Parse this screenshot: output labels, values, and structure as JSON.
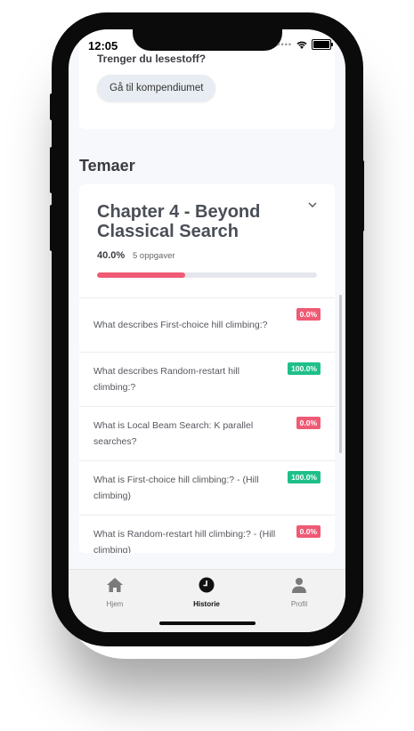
{
  "status": {
    "time": "12:05"
  },
  "top_card": {
    "question": "Trenger du lesestoff?",
    "button_label": "Gå til kompendiumet"
  },
  "section_title": "Temaer",
  "chapter": {
    "title": "Chapter 4 - Beyond Classical Search",
    "progress_label": "40.0%",
    "progress_fraction": 0.4,
    "task_count": "5 oppgaver",
    "items": [
      {
        "text": "What describes First-choice hill climbing:?",
        "badge": "0.0%",
        "status": "red"
      },
      {
        "text": "What describes Random-restart hill climbing:?",
        "badge": "100.0%",
        "status": "green"
      },
      {
        "text": "What is Local Beam Search: K parallel searches?",
        "badge": "0.0%",
        "status": "red"
      },
      {
        "text": "What is First-choice hill climbing:? - (Hill climbing)",
        "badge": "100.0%",
        "status": "green"
      },
      {
        "text": "What is Random-restart hill climbing:? - (Hill climbing)",
        "badge": "0.0%",
        "status": "red"
      }
    ]
  },
  "tabs": [
    {
      "label": "Hjem",
      "icon": "home-icon",
      "active": false
    },
    {
      "label": "Historie",
      "icon": "clock-icon",
      "active": true
    },
    {
      "label": "Profil",
      "icon": "person-icon",
      "active": false
    }
  ],
  "colors": {
    "progress": "#ef5a74",
    "success": "#1fbf8a"
  }
}
